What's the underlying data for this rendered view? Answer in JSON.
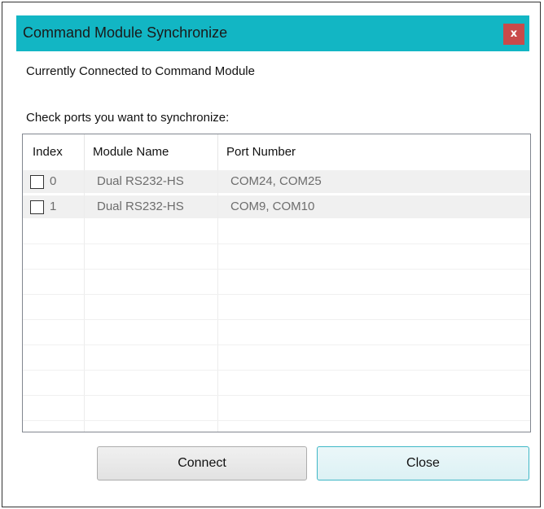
{
  "window": {
    "title": "Command Module Synchronize",
    "close_glyph": "x"
  },
  "status_text": "Currently Connected to Command Module",
  "instruction_text": "Check ports you want to synchronize:",
  "table": {
    "columns": [
      "Index",
      "Module Name",
      "Port Number"
    ],
    "rows": [
      {
        "checked": false,
        "index": "0",
        "module": "Dual RS232-HS",
        "ports": "COM24, COM25"
      },
      {
        "checked": false,
        "index": "1",
        "module": "Dual RS232-HS",
        "ports": "COM9, COM10"
      }
    ]
  },
  "buttons": {
    "connect": "Connect",
    "close": "Close"
  },
  "colors": {
    "titlebar": "#12b6c4",
    "close_button": "#c94a4a"
  }
}
